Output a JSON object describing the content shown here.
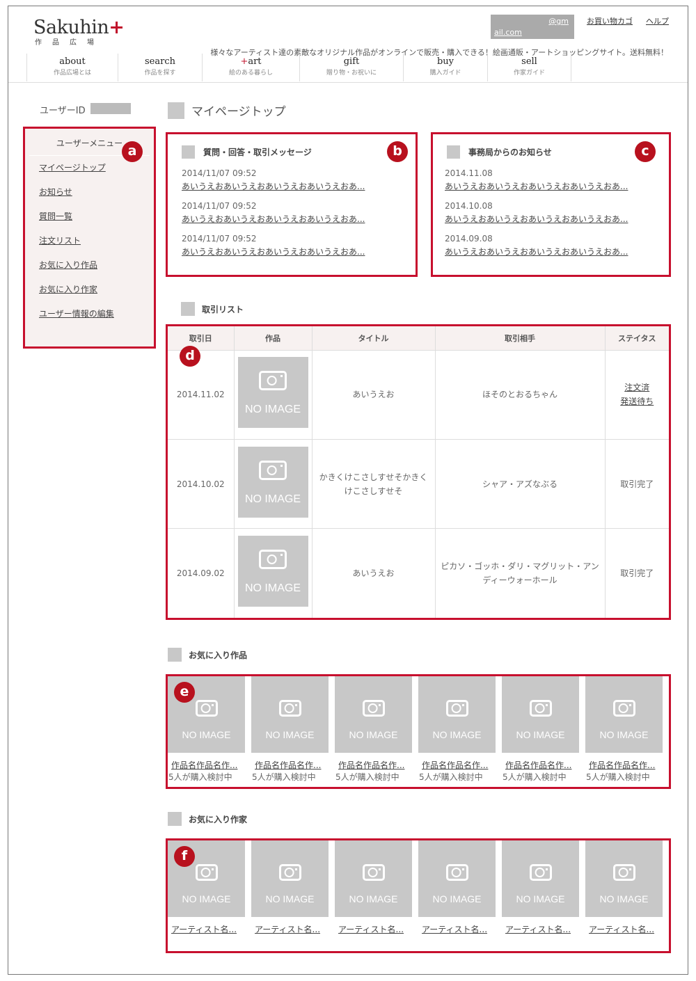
{
  "header": {
    "logo_text": "Sakuhin",
    "logo_plus": "+",
    "logo_sub": "作品広場",
    "email_line1": "@gm",
    "email_line2": "ail.com",
    "cart_label": "お買い物カゴ",
    "help_label": "ヘルプ",
    "tagline": "様々なアーティスト達の素敵なオリジナル作品がオンラインで販売・購入できる！絵画通販・アートショッピングサイト。送料無料！"
  },
  "nav": [
    {
      "title": "about",
      "sub": "作品広場とは"
    },
    {
      "title": "search",
      "sub": "作品を探す"
    },
    {
      "title_plus": "+",
      "title": "art",
      "sub": "絵のある暮らし"
    },
    {
      "title": "gift",
      "sub": "贈り物・お祝いに"
    },
    {
      "title": "buy",
      "sub": "購入ガイド"
    },
    {
      "title": "sell",
      "sub": "作家ガイド"
    }
  ],
  "user": {
    "id_label": "ユーザーID"
  },
  "sidebar": {
    "title": "ユーザーメニュー",
    "items": [
      "マイページトップ",
      "お知らせ",
      "質問一覧",
      "注文リスト",
      "お気に入り作品",
      "お気に入り作家",
      "ユーザー情報の編集"
    ]
  },
  "badges": {
    "a": "a",
    "b": "b",
    "c": "c",
    "d": "d",
    "e": "e",
    "f": "f"
  },
  "page_title": "マイページトップ",
  "messages": {
    "title": "質問・回答・取引メッセージ",
    "items": [
      {
        "date": "2014/11/07 09:52",
        "text": "あいうえおあいうえおあいうえおあいうえおあ..."
      },
      {
        "date": "2014/11/07 09:52",
        "text": "あいうえおあいうえおあいうえおあいうえおあ..."
      },
      {
        "date": "2014/11/07 09:52",
        "text": "あいうえおあいうえおあいうえおあいうえおあ..."
      }
    ]
  },
  "notices": {
    "title": "事務局からのお知らせ",
    "items": [
      {
        "date": "2014.11.08",
        "text": "あいうえおあいうえおあいうえおあいうえおあ..."
      },
      {
        "date": "2014.10.08",
        "text": "あいうえおあいうえおあいうえおあいうえおあ..."
      },
      {
        "date": "2014.09.08",
        "text": "あいうえおあいうえおあいうえおあいうえおあ..."
      }
    ]
  },
  "trades": {
    "title": "取引リスト",
    "columns": [
      "取引日",
      "作品",
      "タイトル",
      "取引相手",
      "ステイタス"
    ],
    "no_image": "NO IMAGE",
    "rows": [
      {
        "date": "2014.11.02",
        "title": "あいうえお",
        "partner": "ほそのとおるちゃん",
        "status": [
          "注文済",
          "発送待ち"
        ]
      },
      {
        "date": "2014.10.02",
        "title": "かきくけこさしすせそかきくけこさしすせそ",
        "partner": "シャア・アズなぶる",
        "status": [
          "取引完了"
        ]
      },
      {
        "date": "2014.09.02",
        "title": "あいうえお",
        "partner": "ピカソ・ゴッホ・ダリ・マグリット・アンディーウォーホール",
        "status": [
          "取引完了"
        ]
      }
    ]
  },
  "fav_works": {
    "title": "お気に入り作品",
    "no_image": "NO IMAGE",
    "items": [
      {
        "name": "作品名作品名作...",
        "sub": "5人が購入検討中"
      },
      {
        "name": "作品名作品名作...",
        "sub": "5人が購入検討中"
      },
      {
        "name": "作品名作品名作...",
        "sub": "5人が購入検討中"
      },
      {
        "name": "作品名作品名作...",
        "sub": "5人が購入検討中"
      },
      {
        "name": "作品名作品名作...",
        "sub": "5人が購入検討中"
      },
      {
        "name": "作品名作品名作...",
        "sub": "5人が購入検討中"
      }
    ]
  },
  "fav_artists": {
    "title": "お気に入り作家",
    "no_image": "NO IMAGE",
    "items": [
      {
        "name": "アーティスト名..."
      },
      {
        "name": "アーティスト名..."
      },
      {
        "name": "アーティスト名..."
      },
      {
        "name": "アーティスト名..."
      },
      {
        "name": "アーティスト名..."
      },
      {
        "name": "アーティスト名..."
      }
    ]
  },
  "colors": {
    "accent": "#c7102e",
    "placeholder": "#c8c8c8",
    "highlight_bg": "#f7f1f0"
  }
}
